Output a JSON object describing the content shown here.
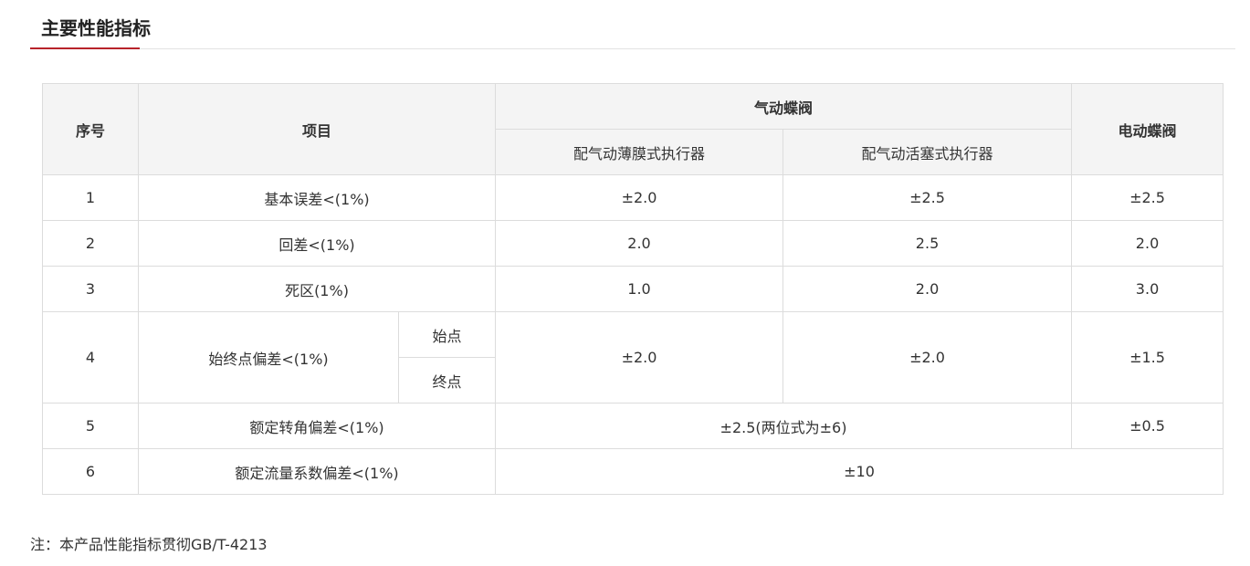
{
  "section": {
    "title": "主要性能指标",
    "accent_color": "#b8232a"
  },
  "table": {
    "headers": {
      "seq": "序号",
      "item": "项目",
      "pneumatic": "气动蝶阀",
      "pneumatic_diaphragm": "配气动薄膜式执行器",
      "pneumatic_piston": "配气动活塞式执行器",
      "electric": "电动蝶阀"
    },
    "rows": [
      {
        "seq": "1",
        "item": "基本误差<(1%)",
        "diaphragm": "±2.0",
        "piston": "±2.5",
        "electric": "±2.5"
      },
      {
        "seq": "2",
        "item": "回差<(1%)",
        "diaphragm": "2.0",
        "piston": "2.5",
        "electric": "2.0"
      },
      {
        "seq": "3",
        "item": "死区(1%)",
        "diaphragm": "1.0",
        "piston": "2.0",
        "electric": "3.0"
      },
      {
        "seq": "4",
        "item": "始终点偏差<(1%)",
        "sub_start": "始点",
        "sub_end": "终点",
        "diaphragm": "±2.0",
        "piston": "±2.0",
        "electric": "±1.5"
      },
      {
        "seq": "5",
        "item": "额定转角偏差<(1%)",
        "pneumatic_merged": "±2.5(两位式为±6)",
        "electric": "±0.5"
      },
      {
        "seq": "6",
        "item": "额定流量系数偏差<(1%)",
        "all_merged": "±10"
      }
    ]
  },
  "note": "注：本产品性能指标贯彻GB/T-4213"
}
